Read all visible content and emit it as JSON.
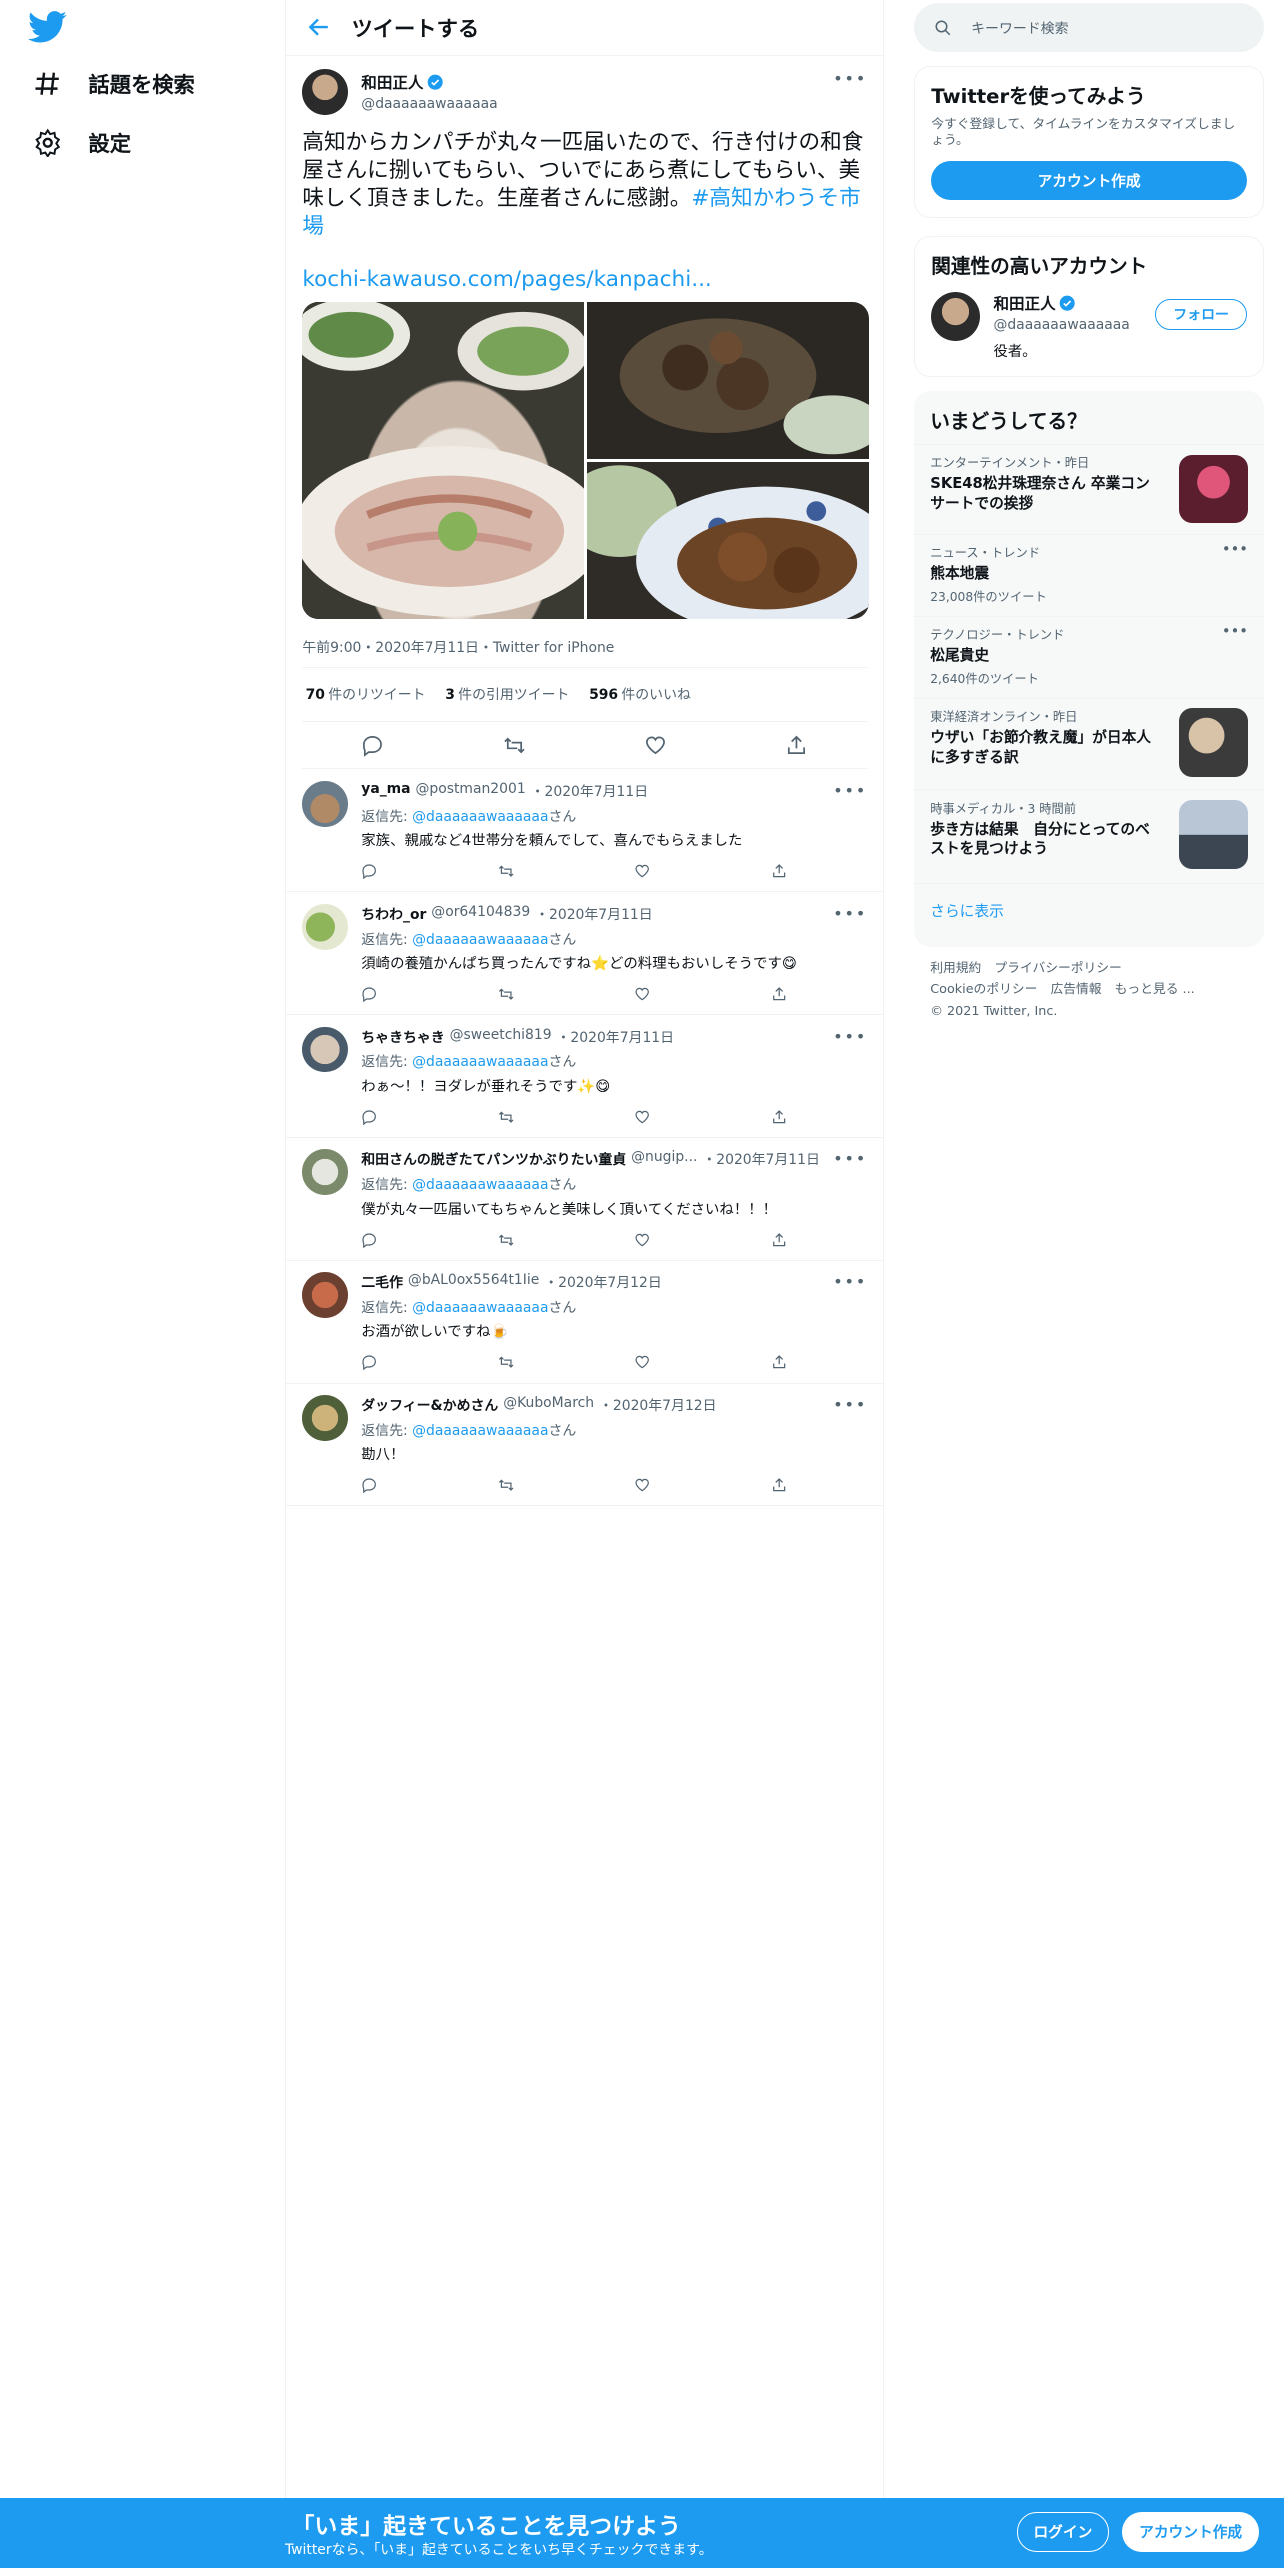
{
  "nav": {
    "explore": "話題を検索",
    "settings": "設定"
  },
  "header": {
    "title": "ツイートする"
  },
  "tweet": {
    "name": "和田正人",
    "handle": "@daaaaaawaaaaaa",
    "text": "高知からカンパチが丸々一匹届いたので、行き付けの和食屋さんに捌いてもらい、ついでにあら煮にしてもらい、美味しく頂きました。生産者さんに感謝。",
    "hashtag": "#高知かわうそ市場",
    "link": "kochi-kawauso.com/pages/kanpachi...",
    "meta": "午前9:00・2020年7月11日・Twitter for iPhone",
    "rt_count": "70",
    "rt_label": "件のリツイート",
    "quote_count": "3",
    "quote_label": "件の引用ツイート",
    "like_count": "596",
    "like_label": "件のいいね"
  },
  "replies": [
    {
      "name": "ya_ma",
      "handle": "@postman2001",
      "date": "・2020年7月11日",
      "to": "@daaaaaawaaaaaa",
      "text": "家族、親戚など4世帯分を頼んでして、喜んでもらえました"
    },
    {
      "name": "ちわわ_or",
      "handle": "@or64104839",
      "date": "・2020年7月11日",
      "to": "@daaaaaawaaaaaa",
      "text": "須崎の養殖かんぱち買ったんですね⭐どの料理もおいしそうです😋"
    },
    {
      "name": "ちゃきちゃき",
      "handle": "@sweetchi819",
      "date": "・2020年7月11日",
      "to": "@daaaaaawaaaaaa",
      "text": "わぁ～！！ヨダレが垂れそうです✨😋"
    },
    {
      "name": "和田さんの脱ぎたてパンツかぶりたい童貞",
      "handle": "@nugip...",
      "date": "・2020年7月11日",
      "to": "@daaaaaawaaaaaa",
      "text": "僕が丸々一匹届いてもちゃんと美味しく頂いてくださいね！！！"
    },
    {
      "name": "二毛作",
      "handle": "@bAL0ox5564t1Iie",
      "date": "・2020年7月12日",
      "to": "@daaaaaawaaaaaa",
      "text": "お酒が欲しいですね🍺"
    },
    {
      "name": "ダッフィー&かめさん",
      "handle": "@KuboMarch",
      "date": "・2020年7月12日",
      "to": "@daaaaaawaaaaaa",
      "text": "勘八！"
    }
  ],
  "reply_prefix": "返信先: ",
  "reply_suffix": "さん",
  "search": {
    "placeholder": "キーワード検索"
  },
  "signup_card": {
    "title": "Twitterを使ってみよう",
    "desc": "今すぐ登録して、タイムラインをカスタマイズしましょう。",
    "button": "アカウント作成"
  },
  "related": {
    "title": "関連性の高いアカウント",
    "name": "和田正人",
    "handle": "@daaaaaawaaaaaa",
    "bio": "役者。",
    "follow": "フォロー"
  },
  "trends": {
    "title": "いまどうしてる？",
    "items": [
      {
        "cat": "エンターテインメント・昨日",
        "title": "SKE48松井珠理奈さん 卒業コンサートでの挨拶",
        "count": ""
      },
      {
        "cat": "ニュース・トレンド",
        "title": "熊本地震",
        "count": "23,008件のツイート"
      },
      {
        "cat": "テクノロジー・トレンド",
        "title": "松尾貴史",
        "count": "2,640件のツイート"
      },
      {
        "cat": "東洋経済オンライン・昨日",
        "title": "ウザい「お節介教え魔」が日本人に多すぎる訳",
        "count": ""
      },
      {
        "cat": "時事メディカル・3 時間前",
        "title": "歩き方は結果　自分にとってのベストを見つけよう",
        "count": ""
      }
    ],
    "more": "さらに表示"
  },
  "footer": {
    "terms": "利用規約",
    "privacy": "プライバシーポリシー",
    "cookie": "Cookieのポリシー",
    "ads": "広告情報",
    "more": "もっと見る ...",
    "copy": "© 2021 Twitter, Inc."
  },
  "bottom": {
    "headline": "「いま」起きていることを見つけよう",
    "sub": "Twitterなら、「いま」起きていることをいち早くチェックできます。",
    "login": "ログイン",
    "signup": "アカウント作成"
  },
  "colors": {
    "accent": "#1d9bf0"
  }
}
